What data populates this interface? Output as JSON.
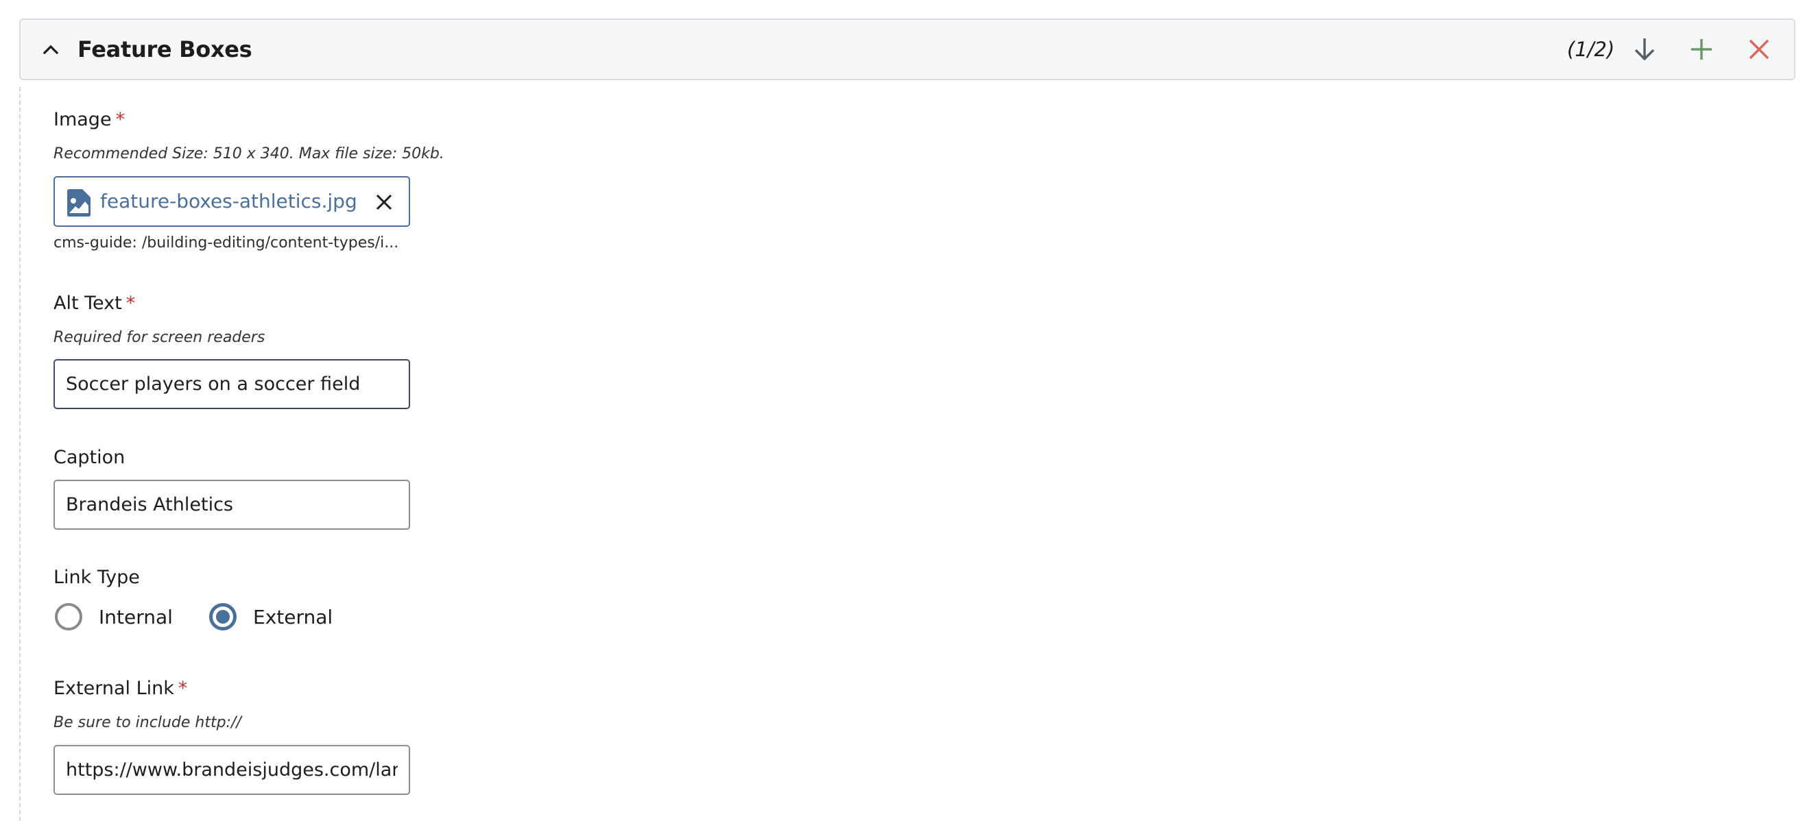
{
  "header": {
    "title": "Feature Boxes",
    "count": "(1/2)",
    "icons": {
      "collapse": "chevron-up-icon",
      "move_down": "arrow-down-icon",
      "add": "plus-icon",
      "remove": "close-icon"
    },
    "colors": {
      "add": "#6a9a64",
      "remove": "#d9665f",
      "move_down": "#5a5e66"
    }
  },
  "fields": {
    "image": {
      "label": "Image",
      "required_mark": "*",
      "hint": "Recommended Size: 510 x 340. Max file size: 50kb.",
      "file_name": "feature-boxes-athletics.jpg",
      "path": "cms-guide: /building-editing/content-types/i..."
    },
    "alt_text": {
      "label": "Alt Text",
      "required_mark": "*",
      "hint": "Required for screen readers",
      "value": "Soccer players on a soccer field"
    },
    "caption": {
      "label": "Caption",
      "value": "Brandeis Athletics"
    },
    "link_type": {
      "label": "Link Type",
      "options": [
        {
          "label": "Internal",
          "checked": false
        },
        {
          "label": "External",
          "checked": true
        }
      ]
    },
    "external_link": {
      "label": "External Link",
      "required_mark": "*",
      "hint": "Be sure to include http://",
      "value": "https://www.brandeisjudges.com/landing/index"
    }
  },
  "colors": {
    "accent": "#4a6f9a",
    "required": "#c6312f",
    "header_bg": "#f5f7f9"
  }
}
